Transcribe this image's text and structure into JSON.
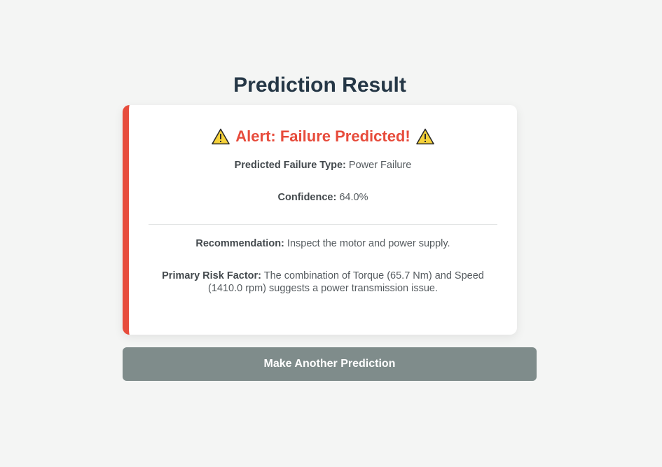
{
  "page": {
    "title": "Prediction Result"
  },
  "result": {
    "alert_text": "Alert: Failure Predicted!",
    "alert_icon": "warning-icon",
    "alert_color": "#e74c3c",
    "failure_type_label": "Predicted Failure Type:",
    "failure_type_value": "Power Failure",
    "confidence_label": "Confidence:",
    "confidence_value": "64.0%",
    "recommendation_label": "Recommendation:",
    "recommendation_value": "Inspect the motor and power supply.",
    "risk_label": "Primary Risk Factor:",
    "risk_value": "The combination of Torque (65.7 Nm) and Speed (1410.0 rpm) suggests a power transmission issue."
  },
  "actions": {
    "another_label": "Make Another Prediction",
    "button_color": "#7f8c8b"
  }
}
